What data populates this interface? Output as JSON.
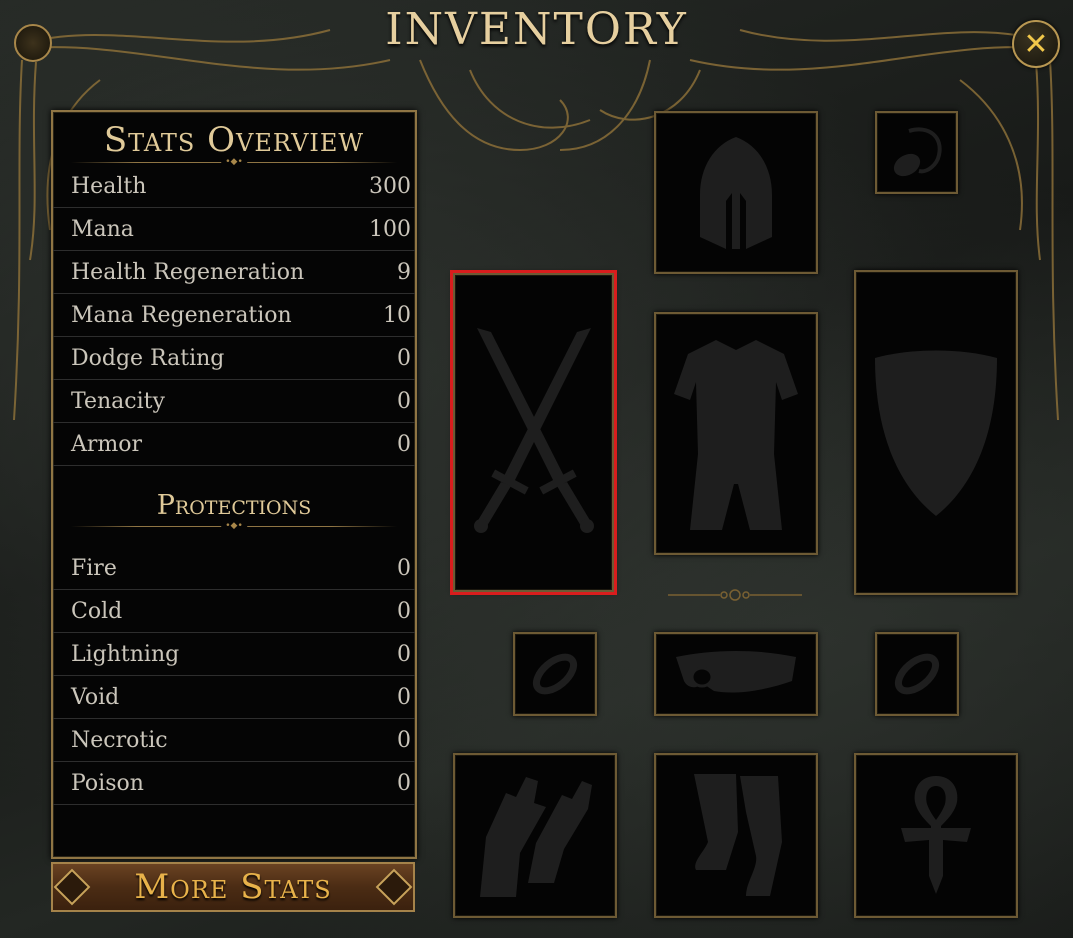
{
  "window": {
    "title": "INVENTORY",
    "close_icon": "close-icon"
  },
  "stats_panel": {
    "heading": "Stats Overview",
    "stats": [
      {
        "label": "Health",
        "value": "300"
      },
      {
        "label": "Mana",
        "value": "100"
      },
      {
        "label": "Health Regeneration",
        "value": "9"
      },
      {
        "label": "Mana Regeneration",
        "value": "10"
      },
      {
        "label": "Dodge Rating",
        "value": "0"
      },
      {
        "label": "Tenacity",
        "value": "0"
      },
      {
        "label": "Armor",
        "value": "0"
      }
    ],
    "protections_heading": "Protections",
    "protections": [
      {
        "label": "Fire",
        "value": "0"
      },
      {
        "label": "Cold",
        "value": "0"
      },
      {
        "label": "Lightning",
        "value": "0"
      },
      {
        "label": "Void",
        "value": "0"
      },
      {
        "label": "Necrotic",
        "value": "0"
      },
      {
        "label": "Poison",
        "value": "0"
      }
    ]
  },
  "more_stats_button": {
    "label": "More Stats"
  },
  "equipment_slots": [
    {
      "slot": "weapon",
      "icon": "crossed-swords-icon",
      "highlighted": true
    },
    {
      "slot": "helmet",
      "icon": "helmet-icon"
    },
    {
      "slot": "amulet",
      "icon": "amulet-icon"
    },
    {
      "slot": "chest",
      "icon": "chest-armor-icon"
    },
    {
      "slot": "offhand",
      "icon": "shield-icon"
    },
    {
      "slot": "ring-left",
      "icon": "ring-icon"
    },
    {
      "slot": "belt",
      "icon": "belt-icon"
    },
    {
      "slot": "ring-right",
      "icon": "ring-icon"
    },
    {
      "slot": "gloves",
      "icon": "gloves-icon"
    },
    {
      "slot": "boots",
      "icon": "boots-icon"
    },
    {
      "slot": "relic",
      "icon": "ankh-icon"
    }
  ],
  "colors": {
    "gold_text": "#e0ca99",
    "button_text": "#e8b24a",
    "slot_border": "#6d5a34",
    "highlight": "#d91d1d",
    "icon_silhouette": "#1e1e1e"
  }
}
